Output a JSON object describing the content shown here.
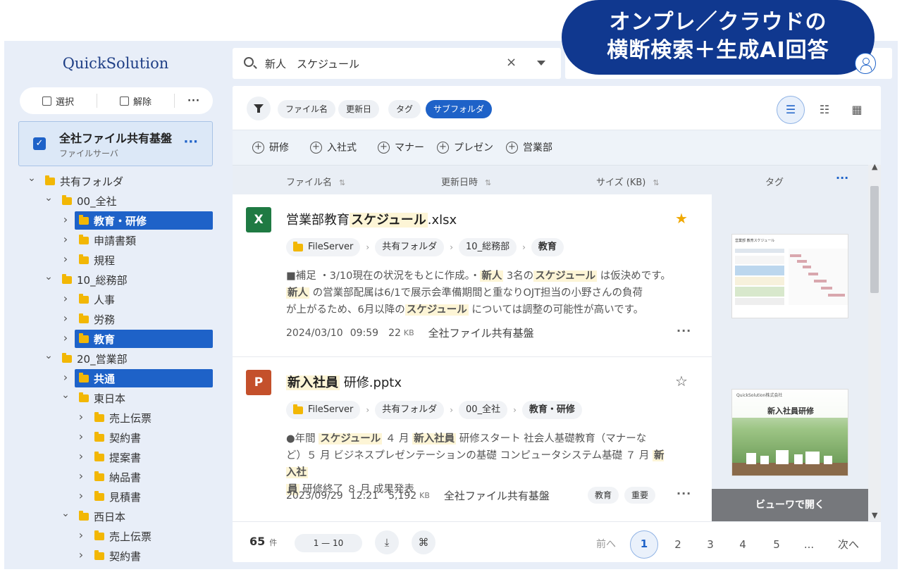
{
  "banner": {
    "line1": "オンプレ／クラウドの",
    "line2": "横断検索＋生成AI回答"
  },
  "sidebar": {
    "logo": "QuickSolution",
    "select_label": "選択",
    "clear_label": "解除",
    "more_label": "···",
    "source": {
      "name": "全社ファイル共有基盤",
      "type": "ファイルサーバ",
      "more": "···"
    },
    "tree": [
      {
        "label": "共有フォルダ",
        "level": 0,
        "open": true,
        "hl": false
      },
      {
        "label": "00_全社",
        "level": 1,
        "open": true,
        "hl": false
      },
      {
        "label": "教育・研修",
        "level": 2,
        "open": false,
        "hl": true
      },
      {
        "label": "申請書類",
        "level": 2,
        "open": false,
        "hl": false
      },
      {
        "label": "規程",
        "level": 2,
        "open": false,
        "hl": false
      },
      {
        "label": "10_総務部",
        "level": 1,
        "open": true,
        "hl": false
      },
      {
        "label": "人事",
        "level": 2,
        "open": false,
        "hl": false
      },
      {
        "label": "労務",
        "level": 2,
        "open": false,
        "hl": false
      },
      {
        "label": "教育",
        "level": 2,
        "open": false,
        "hl": true
      },
      {
        "label": "20_営業部",
        "level": 1,
        "open": true,
        "hl": false
      },
      {
        "label": "共通",
        "level": 2,
        "open": false,
        "hl": true
      },
      {
        "label": "東日本",
        "level": 2,
        "open": true,
        "hl": false
      },
      {
        "label": "売上伝票",
        "level": 3,
        "open": false,
        "hl": false
      },
      {
        "label": "契約書",
        "level": 3,
        "open": false,
        "hl": false
      },
      {
        "label": "提案書",
        "level": 3,
        "open": false,
        "hl": false
      },
      {
        "label": "納品書",
        "level": 3,
        "open": false,
        "hl": false
      },
      {
        "label": "見積書",
        "level": 3,
        "open": false,
        "hl": false
      },
      {
        "label": "西日本",
        "level": 2,
        "open": true,
        "hl": false
      },
      {
        "label": "売上伝票",
        "level": 3,
        "open": false,
        "hl": false
      },
      {
        "label": "契約書",
        "level": 3,
        "open": false,
        "hl": false
      }
    ]
  },
  "search": {
    "query": "新人　スケジュール",
    "clear_icon": "×"
  },
  "filters": {
    "chips": [
      {
        "label": "ファイル名",
        "active": false
      },
      {
        "label": "更新日",
        "active": false
      },
      {
        "label": "タグ",
        "active": false
      },
      {
        "label": "サブフォルダ",
        "active": true
      }
    ],
    "views": [
      "list-view-icon",
      "detail-view-icon",
      "grid-view-icon"
    ]
  },
  "suggested_tags": [
    "研修",
    "入社式",
    "マナー",
    "プレゼン",
    "営業部"
  ],
  "columns": {
    "name": "ファイル名",
    "updated": "更新日時",
    "size": "サイズ (KB)",
    "tags": "タグ",
    "more": "···"
  },
  "results": [
    {
      "icon": "X",
      "icon_color": "#1f7a43",
      "title": [
        "営業部教育",
        "スケジュール",
        ".xlsx"
      ],
      "starred": true,
      "path": [
        "FileServer",
        "共有フォルダ",
        "10_総務部",
        "教育"
      ],
      "snippet": [
        [
          "■補足 ・3/10現在の状況をもとに作成。・",
          "新人",
          " 3名の",
          "スケジュール",
          " は仮決めです。"
        ],
        [
          "新人",
          " の営業部配属は6/1で展示会準備期間と重なりOJT担当の小野さんの負荷"
        ],
        [
          "が上がるため、6月以降の",
          "スケジュール",
          " については調整の可能性が高いです。"
        ]
      ],
      "date": "2024/03/10",
      "time": "09:59",
      "size": "22",
      "size_unit": "KB",
      "source": "全社ファイル共有基盤",
      "tags": []
    },
    {
      "icon": "P",
      "icon_color": "#c4502b",
      "title": [
        "新入社員",
        " 研修.pptx",
        ""
      ],
      "starred": false,
      "path": [
        "FileServer",
        "共有フォルダ",
        "00_全社",
        "教育・研修"
      ],
      "snippet": [
        [
          "●年間 ",
          "スケジュール",
          " ４ 月 ",
          "新入社員",
          " 研修スタート 社会人基礎教育（マナーな"
        ],
        [
          "ど）５ 月 ビジネスプレゼンテーションの基礎 コンピュータシステム基礎 ７ 月 ",
          "新入社"
        ],
        [
          "員",
          " 研修終了 ８ 月 成果発表"
        ]
      ],
      "date": "2023/09/29",
      "time": "12:21",
      "size": "5,192",
      "size_unit": "KB",
      "source": "全社ファイル共有基盤",
      "tags": [
        "教育",
        "重要"
      ]
    }
  ],
  "preview": {
    "thumb1_caption": "営業部 教育スケジュール",
    "thumb2_caption": "QuickSolution株式会社",
    "thumb2_title": "新入社員研修",
    "open_viewer": "ビューワで開く"
  },
  "footer": {
    "count": "65",
    "count_unit": "件",
    "range": "1 — 10",
    "prev": "前へ",
    "pages": [
      "1",
      "2",
      "3",
      "4",
      "5",
      "..."
    ],
    "next": "次へ"
  },
  "colors": {
    "accent": "#1e62c8",
    "banner": "#10388f",
    "folder": "#f2b705",
    "highlight": "#fdf5d6"
  }
}
